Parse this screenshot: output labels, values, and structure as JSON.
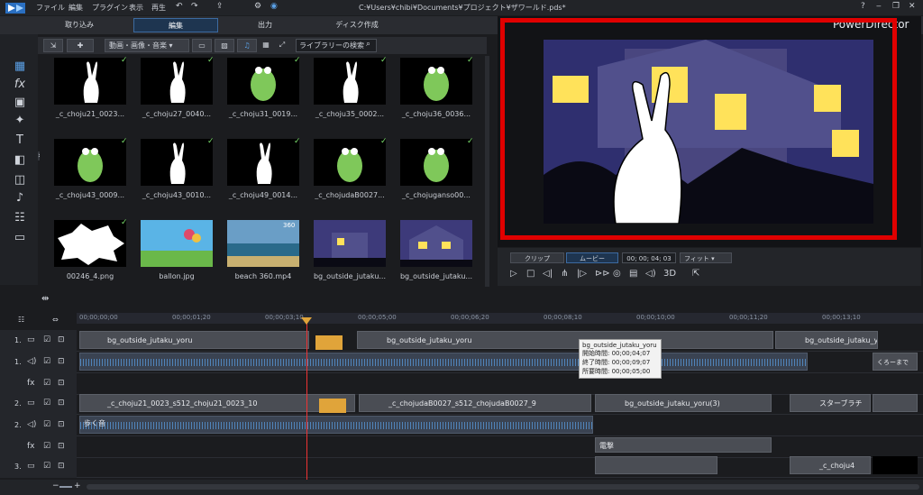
{
  "app": {
    "window_path": "C:¥Users¥chibi¥Documents¥プロジェクト¥ザワールド.pds*",
    "brand": "PowerDirector"
  },
  "menu": [
    "ファイル",
    "編集",
    "プラグイン",
    "表示",
    "再生"
  ],
  "tabs": [
    {
      "label": "取り込み"
    },
    {
      "label": "編集",
      "active": true
    },
    {
      "label": "出力"
    },
    {
      "label": "ディスク作成"
    }
  ],
  "library": {
    "filter": "動画・画像・音楽",
    "search_placeholder": "ライブラリーの検索",
    "items": [
      {
        "label": "_c_choju21_0023...",
        "checked": true,
        "kind": "rabbit"
      },
      {
        "label": "_c_choju27_0040...",
        "checked": true,
        "kind": "rabbit"
      },
      {
        "label": "_c_choju31_0019...",
        "checked": true,
        "kind": "frog"
      },
      {
        "label": "_c_choju35_0002...",
        "checked": true,
        "kind": "rabbit"
      },
      {
        "label": "_c_choju36_0036...",
        "checked": true,
        "kind": "frog"
      },
      {
        "label": "_c_choju43_0009...",
        "checked": true,
        "kind": "frog"
      },
      {
        "label": "_c_choju43_0010...",
        "checked": true,
        "kind": "rabbit"
      },
      {
        "label": "_c_choju49_0014...",
        "checked": true,
        "kind": "rabbit"
      },
      {
        "label": "_c_chojudaB0027...",
        "checked": true,
        "kind": "frog"
      },
      {
        "label": "_c_chojuganso00...",
        "checked": true,
        "kind": "frog"
      },
      {
        "label": "00246_4.png",
        "checked": true,
        "kind": "burst"
      },
      {
        "label": "ballon.jpg",
        "checked": false,
        "kind": "sky"
      },
      {
        "label": "beach 360.mp4",
        "checked": false,
        "kind": "beach",
        "badge": "360"
      },
      {
        "label": "bg_outside_jutaku...",
        "checked": false,
        "kind": "house"
      },
      {
        "label": "bg_outside_jutaku...",
        "checked": false,
        "kind": "house2"
      }
    ]
  },
  "preview": {
    "clip_btn": "クリップ",
    "movie_btn": "ムービー",
    "timecode": "00; 00; 04; 03",
    "fit": "フィット",
    "mode_3d": "3D"
  },
  "ruler": [
    "00;00;00;00",
    "00;00;01;20",
    "00;00;03;10",
    "00;00;05;00",
    "00;00;06;20",
    "00;00;08;10",
    "00;00;10;00",
    "00;00;11;20",
    "00;00;13;10"
  ],
  "tracks": {
    "labels": [
      "1.",
      "1.",
      "fx",
      "2.",
      "2.",
      "fx",
      "3."
    ],
    "clips": {
      "c1": "bg_outside_jutaku_yoru",
      "c2": "bg_outside_jutaku_yoru",
      "c3": "bg_outside_jutaku_yoru",
      "c4": "_c_choju21_0023_s512_choju21_0023_10",
      "c5": "_c_chojudaB0027_s512_chojudaB0027_9",
      "c6": "bg_outside_jutaku_yoru(3)",
      "c7": "スターブラチ",
      "c8": "くろーまで",
      "aud1": "歩く音",
      "fx2": "電撃",
      "c9": "_c_choju4"
    }
  },
  "tooltip": {
    "title": "bg_outside_jutaku_yoru",
    "start": "開始時間: 00;00;04;07",
    "end": "終了時間: 00;00;09;07",
    "dur": "所要時間: 00;00;05;00"
  },
  "colors": {
    "accent": "#3c6aa0",
    "highlight": "#e00000",
    "playhead": "#e33333"
  }
}
